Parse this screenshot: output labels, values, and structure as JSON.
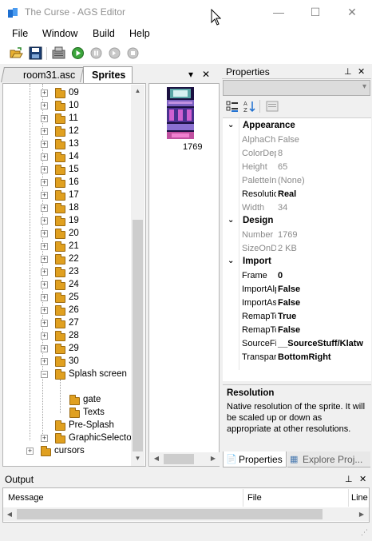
{
  "window": {
    "title": "The Curse - AGS Editor",
    "minimize": "—",
    "maximize": "☐",
    "close": "✕"
  },
  "menu": [
    "File",
    "Window",
    "Build",
    "Help"
  ],
  "toolbar": [
    "open-folder-icon",
    "save-icon",
    "build-icon",
    "run-icon",
    "pause-icon",
    "step-icon",
    "stop-icon"
  ],
  "tabs": {
    "room": "room31.asc",
    "sprites": "Sprites",
    "dropdown": "▾",
    "close": "✕"
  },
  "tree": {
    "numbered_folders": [
      "09",
      "10",
      "11",
      "12",
      "13",
      "14",
      "15",
      "16",
      "17",
      "18",
      "19",
      "20",
      "21",
      "22",
      "23",
      "24",
      "25",
      "26",
      "27",
      "28",
      "29",
      "30"
    ],
    "splash_screen": "Splash screen",
    "splash_children": [
      "gate",
      "Texts"
    ],
    "pre_splash": "Pre-Splash",
    "graphic_selector": "GraphicSelector",
    "cursors": "cursors"
  },
  "sprite": {
    "number": "1769"
  },
  "properties": {
    "title": "Properties",
    "pin": "📌",
    "close": "✕",
    "categories": [
      {
        "name": "Appearance",
        "rows": [
          {
            "name": "AlphaChannel",
            "value": "False",
            "style": "grey"
          },
          {
            "name": "ColorDepth",
            "value": "8",
            "style": "grey"
          },
          {
            "name": "Height",
            "value": "65",
            "style": "grey"
          },
          {
            "name": "PaletteIndex",
            "value": "(None)",
            "style": "grey"
          },
          {
            "name": "Resolution",
            "value": "Real",
            "style": "bold"
          },
          {
            "name": "Width",
            "value": "34",
            "style": "grey"
          }
        ]
      },
      {
        "name": "Design",
        "rows": [
          {
            "name": "Number",
            "value": "1769",
            "style": "grey"
          },
          {
            "name": "SizeOnDisk",
            "value": "2 KB",
            "style": "grey"
          }
        ]
      },
      {
        "name": "Import",
        "rows": [
          {
            "name": "Frame",
            "value": "0",
            "style": "bold"
          },
          {
            "name": "ImportAlpha",
            "value": "False",
            "style": "bold"
          },
          {
            "name": "ImportAsTile",
            "value": "False",
            "style": "bold"
          },
          {
            "name": "RemapToGame",
            "value": "True",
            "style": "bold"
          },
          {
            "name": "RemapToRoom",
            "value": "False",
            "style": "bold"
          },
          {
            "name": "SourceFile",
            "value": "__SourceStuff/Klatw",
            "style": "bold"
          },
          {
            "name": "Transparency",
            "value": "BottomRight",
            "style": "bold"
          }
        ]
      }
    ],
    "description_title": "Resolution",
    "description_text": "Native resolution of the sprite. It will be scaled up or down as appropriate at other resolutions.",
    "bottom_tabs": [
      "Properties",
      "Explore Proj..."
    ]
  },
  "output": {
    "title": "Output",
    "columns": [
      "Message",
      "File",
      "Line"
    ]
  }
}
